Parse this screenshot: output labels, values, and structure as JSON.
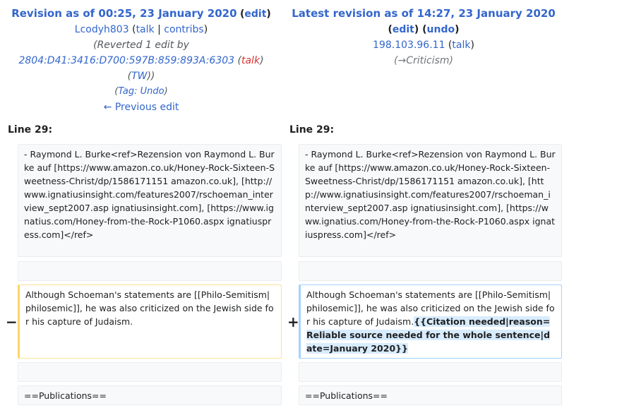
{
  "left": {
    "title": "Revision as of 00:25, 23 January 2020",
    "edit": "edit",
    "user": "Lcodyh803",
    "talk": "talk",
    "sep": "|",
    "contribs": "contribs",
    "summary_line1": "(Reverted 1 edit by",
    "ip": "2804:D41:3416:D700:597B:859:893A:6303",
    "ip_talk": "talk",
    "tw": "TW",
    "tag_label": "Tag:",
    "tag_value": "Undo",
    "prev": "← Previous edit",
    "line_label": "Line 29:"
  },
  "right": {
    "title": "Latest revision as of 14:27, 23 January 2020",
    "edit": "edit",
    "undo": "undo",
    "user": "198.103.96.11",
    "talk": "talk",
    "summary_arrow": "(→",
    "summary_section": "Criticism",
    "summary_close": ")",
    "line_label": "Line 29:"
  },
  "diff": {
    "context_left": "- Raymond L. Burke<ref>Rezension von Raymond L. Burke auf [https://www.amazon.co.uk/Honey-Rock-Sixteen-Sweetness-Christ/dp/1586171151 amazon.co.uk], [http://www.ignatiusinsight.com/features2007/rschoeman_interview_sept2007.asp ignatiusinsight.com], [https://www.ignatius.com/Honey-from-the-Rock-P1060.aspx ignatiuspress.com]</ref>",
    "context_right": "- Raymond L. Burke<ref>Rezension von Raymond L. Burke auf [https://www.amazon.co.uk/Honey-Rock-Sixteen-Sweetness-Christ/dp/1586171151 amazon.co.uk], [http://www.ignatiusinsight.com/features2007/rschoeman_interview_sept2007.asp ignatiusinsight.com], [https://www.ignatius.com/Honey-from-the-Rock-P1060.aspx ignatiuspress.com]</ref>",
    "minus": "−",
    "plus": "+",
    "removed": "Although Schoeman's statements are [[Philo-Semitism|philosemic]], he was also criticized on the Jewish side for his capture of Judaism.",
    "added_base": "Although Schoeman's statements are [[Philo-Semitism|philosemic]], he was also criticized on the Jewish side for his capture of Judaism.",
    "added_inline": "{{Citation needed|reason=Reliable source needed for the whole sentence|date=January 2020}}",
    "publications_left": "==Publications==",
    "publications_right": "==Publications=="
  }
}
